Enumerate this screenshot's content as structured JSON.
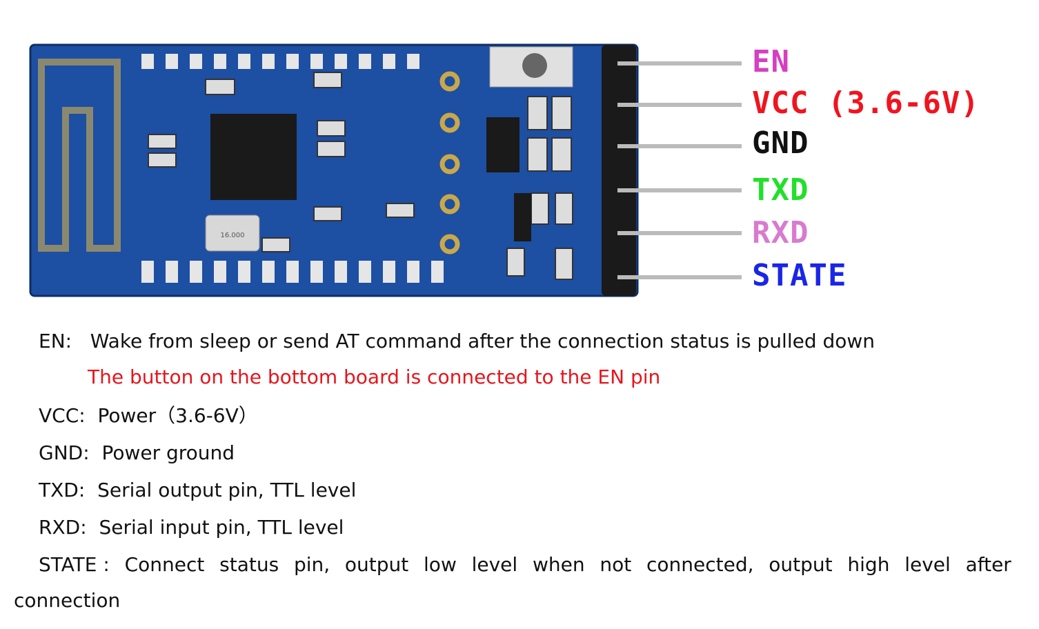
{
  "pins": [
    {
      "label": "EN",
      "color": "#d63fc0"
    },
    {
      "label": "VCC (3.6-6V)",
      "color": "#f0141e"
    },
    {
      "label": "GND",
      "color": "#111111"
    },
    {
      "label": "TXD",
      "color": "#22e02a"
    },
    {
      "label": "RXD",
      "color": "#d77bd0"
    },
    {
      "label": "STATE",
      "color": "#1a26e6"
    }
  ],
  "board": {
    "pcb_color": "#1d4fa3",
    "crystal_marking": "16.000"
  },
  "descriptions": {
    "en": {
      "key": "EN:",
      "text": "Wake from sleep or send AT command after the connection status is pulled down",
      "note": "The button on the bottom board is connected to the EN pin"
    },
    "vcc": {
      "key": "VCC:",
      "text": "Power（3.6-6V）"
    },
    "gnd": {
      "key": "GND:",
      "text": "Power ground"
    },
    "txd": {
      "key": "TXD:",
      "text": "Serial output pin, TTL level"
    },
    "rxd": {
      "key": "RXD:",
      "text": "Serial input pin, TTL level"
    },
    "state": {
      "key": "STATE :",
      "words": [
        "Connect",
        "status",
        "pin,",
        "output",
        "low",
        "level",
        "when",
        "not",
        "connected,",
        "output",
        "high",
        "level",
        "after"
      ],
      "continuation": "connection"
    }
  }
}
